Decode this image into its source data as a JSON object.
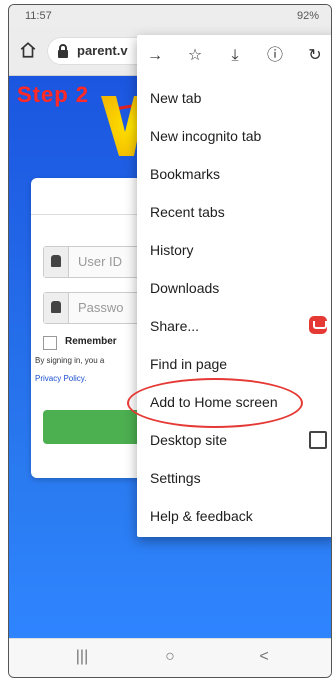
{
  "status_bar": {
    "time": "11:57",
    "right": "92%"
  },
  "url_bar": {
    "url_text": "parent.v"
  },
  "tutorial": {
    "step_label": "Step 2"
  },
  "website": {
    "user_id_placeholder": "User ID",
    "password_placeholder": "Passwo",
    "remember_label": "Remember",
    "signing_text": "By signing in, you a",
    "privacy_link": "Privacy Policy."
  },
  "menu": {
    "top_icons": [
      "arrow-forward-icon",
      "star-icon",
      "download-icon",
      "info-icon",
      "refresh-icon"
    ],
    "items": [
      {
        "label": "New tab"
      },
      {
        "label": "New incognito tab"
      },
      {
        "label": "Bookmarks"
      },
      {
        "label": "Recent tabs"
      },
      {
        "label": "History"
      },
      {
        "label": "Downloads"
      },
      {
        "label": "Share..."
      },
      {
        "label": "Find in page"
      },
      {
        "label": "Add to Home screen"
      },
      {
        "label": "Desktop site"
      },
      {
        "label": "Settings"
      },
      {
        "label": "Help & feedback"
      }
    ]
  },
  "bottom_nav": {
    "recents": "|||",
    "home": "○",
    "back": "<"
  },
  "colors": {
    "site_blue": "#2a6ff0",
    "highlight_red": "#e53935",
    "login_green": "#4caf50"
  }
}
